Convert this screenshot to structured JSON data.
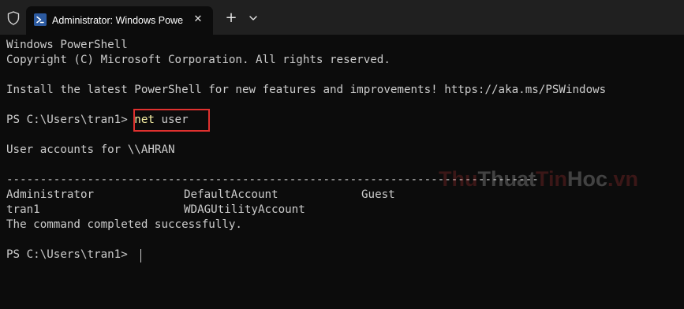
{
  "window": {
    "tab_title": "Administrator: Windows PowerShell",
    "close_glyph": "✕",
    "new_tab_glyph": "+",
    "icons": [
      "shield-icon",
      "powershell-icon",
      "close-icon",
      "plus-icon",
      "chevron-down-icon"
    ]
  },
  "terminal": {
    "header_line1": "Windows PowerShell",
    "header_line2": "Copyright (C) Microsoft Corporation. All rights reserved.",
    "install_line": "Install the latest PowerShell for new features and improvements! https://aka.ms/PSWindows",
    "prompt1": "PS C:\\Users\\tran1> ",
    "command_keyword": "net",
    "command_args": " user",
    "accounts_header": "User accounts for \\\\AHRAN",
    "separator": "-------------------------------------------------------------------------------",
    "accounts_row1": [
      "Administrator",
      "DefaultAccount",
      "Guest"
    ],
    "accounts_row2": [
      "tran1",
      "WDAGUtilityAccount"
    ],
    "completed": "The command completed successfully.",
    "prompt2": "PS C:\\Users\\tran1> "
  },
  "watermark": {
    "part1": "Thu",
    "part2": "Thuat",
    "part3": "Tin",
    "part4": "Hoc",
    "part5": ".vn"
  },
  "colors": {
    "background": "#0c0c0c",
    "tabbar": "#202020",
    "text": "#cccccc",
    "command_keyword": "#f9f1a5",
    "highlight_border": "#e0312f"
  }
}
